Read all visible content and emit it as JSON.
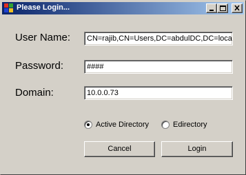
{
  "window": {
    "title": "Please Login..."
  },
  "form": {
    "username_label": "User Name:",
    "username_value": "CN=rajib,CN=Users,DC=abdulDC,DC=local",
    "password_label": "Password:",
    "password_value": "####",
    "domain_label": "Domain:",
    "domain_value": "10.0.0.73"
  },
  "options": {
    "active_directory_label": "Active Directory",
    "active_directory_selected": true,
    "edirectory_label": "Edirectory",
    "edirectory_selected": false
  },
  "buttons": {
    "cancel_label": "Cancel",
    "login_label": "Login"
  },
  "icons": [
    "app-icon",
    "minimize-icon",
    "maximize-icon",
    "close-icon"
  ],
  "colors": {
    "titlebar_start": "#0a246a",
    "titlebar_end": "#a6caf0",
    "window_bg": "#d4d0c8"
  }
}
